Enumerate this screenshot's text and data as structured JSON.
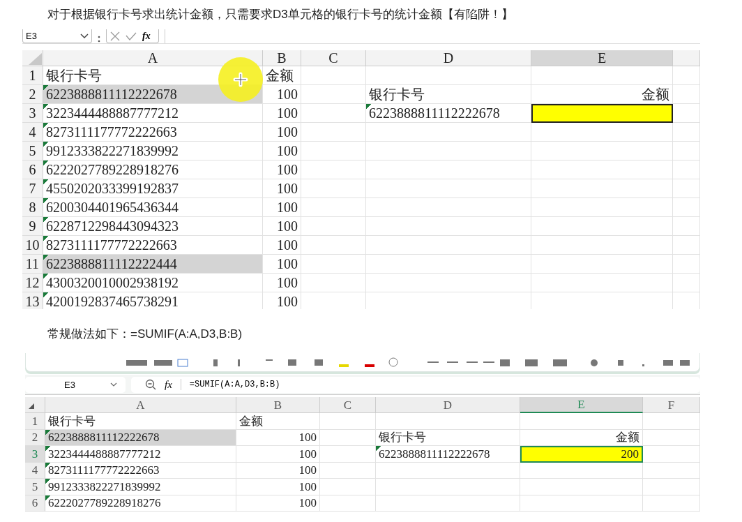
{
  "intro": "对于根据银行卡号求出统计金额，只需要求D3单元格的银行卡号的统计金额【有陷阱！】",
  "sheets": [
    {
      "kind": "excel",
      "name_box": "E3",
      "fx": "fx",
      "columns": [
        {
          "label": "A",
          "selected": false
        },
        {
          "label": "B",
          "selected": false
        },
        {
          "label": "C",
          "selected": false
        },
        {
          "label": "D",
          "selected": false
        },
        {
          "label": "E",
          "selected": true
        }
      ],
      "rows": [
        {
          "number": "1",
          "selected": false,
          "shaded": false,
          "active": false,
          "highlighted": false,
          "cells": {
            "A": "银行卡号",
            "B": "金额"
          }
        },
        {
          "number": "2",
          "selected": false,
          "shaded": true,
          "active": false,
          "highlighted": false,
          "cells": {
            "A": "6223888811112222678",
            "B": "100",
            "D": "银行卡号",
            "E": "金额"
          }
        },
        {
          "number": "3",
          "selected": false,
          "shaded": false,
          "active": true,
          "highlighted": true,
          "cells": {
            "A": "3223444488887777212",
            "B": "100",
            "D": "6223888811112222678"
          }
        },
        {
          "number": "4",
          "selected": false,
          "shaded": false,
          "active": false,
          "highlighted": false,
          "cells": {
            "A": "8273111177772222663",
            "B": "100"
          }
        },
        {
          "number": "5",
          "selected": false,
          "shaded": false,
          "active": false,
          "highlighted": false,
          "cells": {
            "A": "9912333822271839992",
            "B": "100"
          }
        },
        {
          "number": "6",
          "selected": false,
          "shaded": false,
          "active": false,
          "highlighted": false,
          "cells": {
            "A": "6222027789228918276",
            "B": "100"
          }
        },
        {
          "number": "7",
          "selected": false,
          "shaded": false,
          "active": false,
          "highlighted": false,
          "cells": {
            "A": "4550202033399192837",
            "B": "100"
          }
        },
        {
          "number": "8",
          "selected": false,
          "shaded": false,
          "active": false,
          "highlighted": false,
          "cells": {
            "A": "6200304401965436344",
            "B": "100"
          }
        },
        {
          "number": "9",
          "selected": false,
          "shaded": false,
          "active": false,
          "highlighted": false,
          "cells": {
            "A": "6228712298443094323",
            "B": "100"
          }
        },
        {
          "number": "10",
          "selected": false,
          "shaded": false,
          "active": false,
          "highlighted": false,
          "cells": {
            "A": "8273111177772222663",
            "B": "100"
          }
        },
        {
          "number": "11",
          "selected": false,
          "shaded": true,
          "active": false,
          "highlighted": false,
          "cells": {
            "A": "6223888811112222444",
            "B": "100"
          }
        },
        {
          "number": "12",
          "selected": false,
          "shaded": false,
          "active": false,
          "highlighted": false,
          "cells": {
            "A": "4300320010002938192",
            "B": "100"
          }
        },
        {
          "number": "13",
          "selected": false,
          "shaded": false,
          "active": false,
          "highlighted": false,
          "cells": {
            "A": "4200192837465738291",
            "B": "100"
          }
        }
      ]
    },
    {
      "kind": "wps",
      "name_box": "E3",
      "fx": "fx",
      "formula": "=SUMIF(A:A,D3,B:B)",
      "columns": [
        {
          "label": "A",
          "selected": false
        },
        {
          "label": "B",
          "selected": false
        },
        {
          "label": "C",
          "selected": false
        },
        {
          "label": "D",
          "selected": false
        },
        {
          "label": "E",
          "selected": true
        },
        {
          "label": "F",
          "selected": false
        }
      ],
      "rows": [
        {
          "number": "1",
          "selected": false,
          "shaded": false,
          "active": false,
          "highlighted": false,
          "cells": {
            "A": "银行卡号",
            "B": "金额"
          }
        },
        {
          "number": "2",
          "selected": false,
          "shaded": true,
          "active": false,
          "highlighted": false,
          "cells": {
            "A": "6223888811112222678",
            "B": "100",
            "D": "银行卡号",
            "E": "金额"
          }
        },
        {
          "number": "3",
          "selected": true,
          "shaded": false,
          "active": true,
          "highlighted": true,
          "cells": {
            "A": "3223444488887777212",
            "B": "100",
            "D": "6223888811112222678",
            "E": "200"
          }
        },
        {
          "number": "4",
          "selected": false,
          "shaded": false,
          "active": false,
          "highlighted": false,
          "cells": {
            "A": "8273111177772222663",
            "B": "100"
          }
        },
        {
          "number": "5",
          "selected": false,
          "shaded": false,
          "active": false,
          "highlighted": false,
          "cells": {
            "A": "9912333822271839992",
            "B": "100"
          }
        },
        {
          "number": "6",
          "selected": false,
          "shaded": false,
          "active": false,
          "highlighted": false,
          "cells": {
            "A": "6222027789228918276",
            "B": "100"
          }
        }
      ]
    }
  ],
  "between": "常规做法如下：=SUMIF(A:A,D3,B:B)"
}
